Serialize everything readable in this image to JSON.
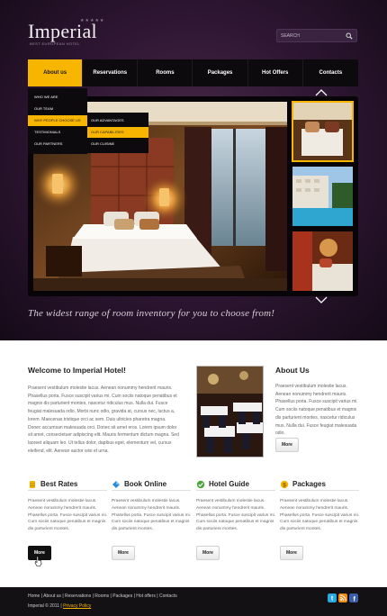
{
  "logo": {
    "title": "Imperial",
    "stars": "★★★★★",
    "tagline": "BEST EUROPEAN HOTEL"
  },
  "search": {
    "placeholder": "SEARCH"
  },
  "nav": {
    "items": [
      "About us",
      "Reservations",
      "Rooms",
      "Packages",
      "Hot Offers",
      "Contacts"
    ],
    "active": "About us"
  },
  "dropdown": {
    "items": [
      "WHO WE ARE",
      "OUR TEAM",
      "WHY PEOPLE CHOOSE US",
      "TESTIMONIALS",
      "OUR PARTNERS"
    ],
    "active": "WHY PEOPLE CHOOSE US"
  },
  "submenu": {
    "items": [
      "OUR ADVANTAGES",
      "OUR CAPABILITIES",
      "OUR CUISINE"
    ],
    "active": "OUR CAPABILITIES"
  },
  "slogan": "The widest range of room inventory for you to choose from!",
  "welcome": {
    "title": "Welcome to Imperial Hotel!",
    "text": "Praesent vestibulum molestie lacus. Aenean nonummy hendrerit mauris. Phasellus porta. Fusce suscipit varius mi. Cum sociis natoque penatibus et magnis dis parturient montes, nascetur ridiculus mus. Nulla dui. Fusce feugiat malesuada odio. Morbi nunc odio, gravida at, cursus nec, luctus a, lorem. Maecenas tristique orci ac sem. Duis ultricies pharetra magna. Donec accumsan malesuada orci. Donec sit amet eros. Lorem ipsum dolor sit amet, consectetuer adipiscing elit. Mauris fermentum dictum magna. Sed laoreet aliquam leo. Ut tellus dolor, dapibus eget, elementum vel, cursus eleifend, elit. Aenean auctor wisi et urna."
  },
  "about": {
    "title": "About Us",
    "text": "Praesent vestibulum molestie lacus. Aenean nonummy hendrerit mauris. Phasellus porta. Fusce suscipit varius mi. Cum sociis natoque penatibus et magnis dis parturient montes, nascetur ridiculus mus. Nulla dui. Fusce feugiat malesuada odio.",
    "button": "More"
  },
  "features": [
    {
      "title": "Best Rates",
      "text": "Praesent vestibulum molestie lacus. Aenean nonummy hendrerit mauris. Phasellus porta. Fusce suscipit varius mi. Cum sociis natoque penatibus et magnis dis parturient montes.",
      "button": "More",
      "icon": "coins-icon"
    },
    {
      "title": "Book Online",
      "text": "Praesent vestibulum molestie lacus. Aenean nonummy hendrerit mauris. Phasellus porta. Fusce suscipit varius mi. Cum sociis natoque penatibus et magnis dis parturient montes.",
      "button": "More",
      "icon": "diamond-icon"
    },
    {
      "title": "Hotel Guide",
      "text": "Praesent vestibulum molestie lacus. Aenean nonummy hendrerit mauris. Phasellus porta. Fusce suscipit varius mi. Cum sociis natoque penatibus et magnis dis parturient montes.",
      "button": "More",
      "icon": "check-circle-icon"
    },
    {
      "title": "Packages",
      "text": "Praesent vestibulum molestie lacus. Aenean nonummy hendrerit mauris. Phasellus porta. Fusce suscipit varius mi. Cum sociis natoque penatibus et magnis dis parturient montes.",
      "button": "More",
      "icon": "dollar-coin-icon"
    }
  ],
  "footer": {
    "links": [
      "Home",
      "About us",
      "Reservations",
      "Rooms",
      "Packages",
      "Hot offers",
      "Contacts"
    ],
    "separator": "|",
    "copyright": "Imperial © 2011 |",
    "privacy": "Privacy Policy"
  },
  "colors": {
    "accent": "#f7b500",
    "nav_bg": "#0c0a0c",
    "hero_bg": "#2c1530",
    "footer_bg": "#141114"
  }
}
